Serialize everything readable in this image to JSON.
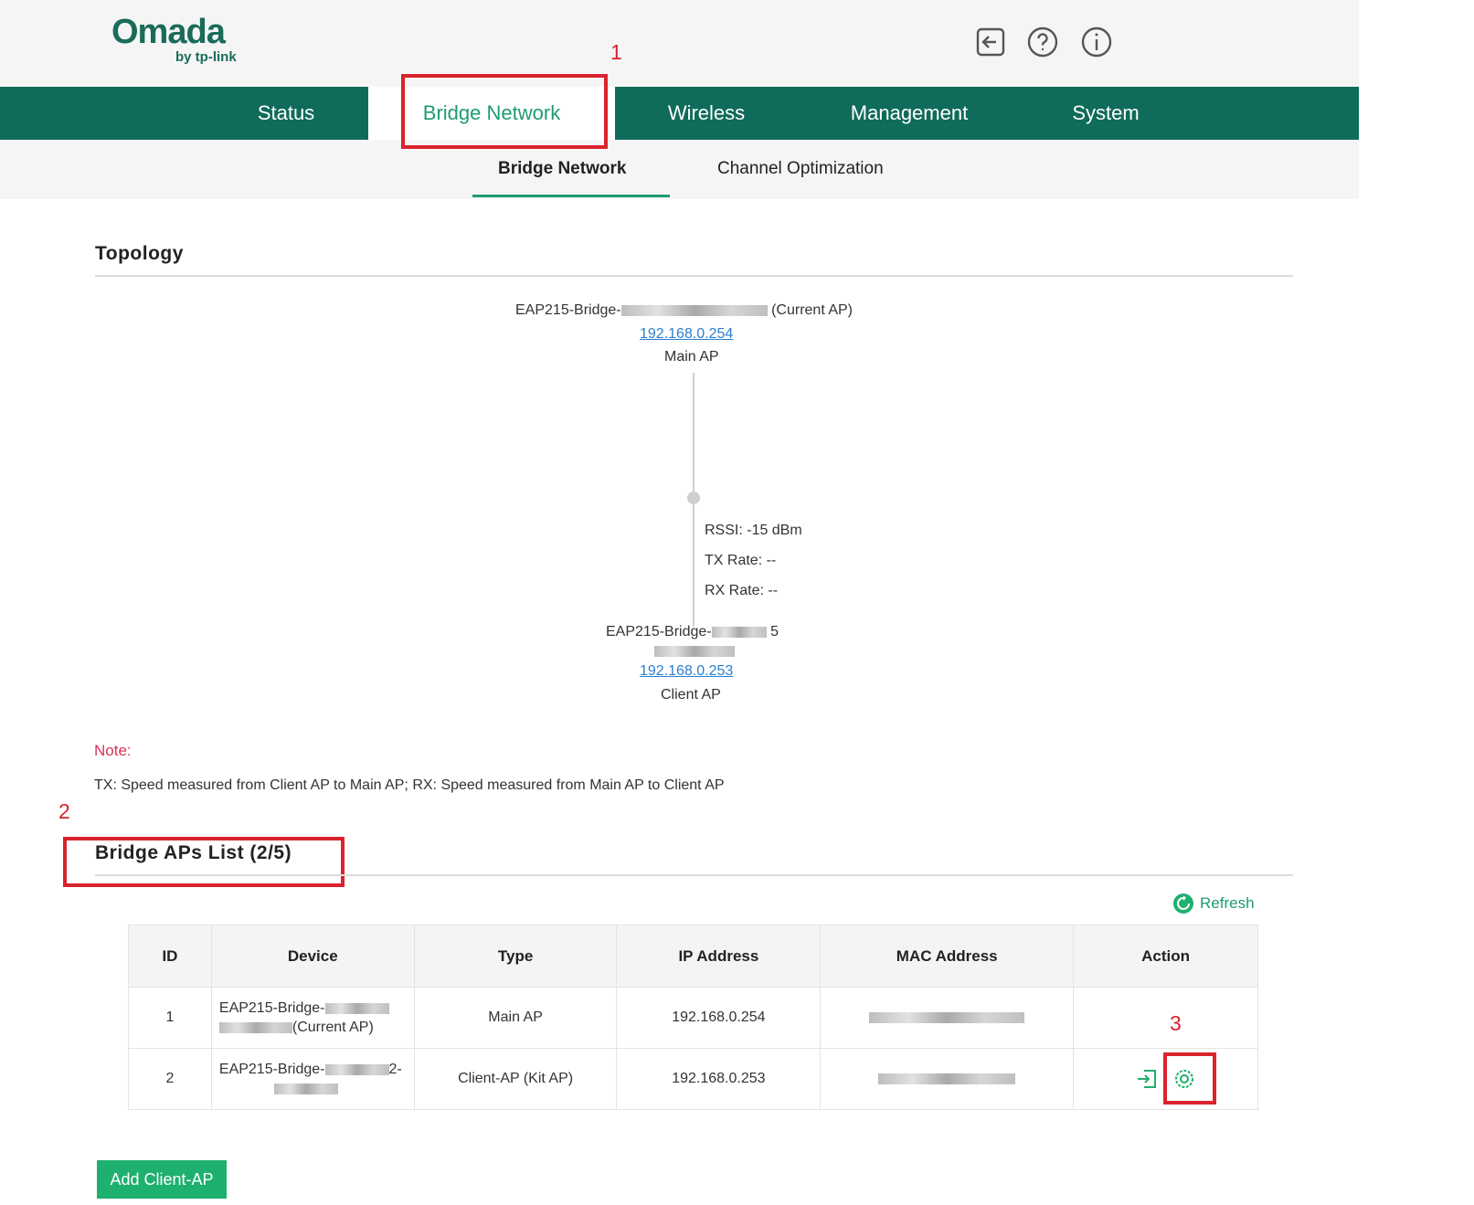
{
  "header": {
    "logo_main": "Omada",
    "logo_sub": "by tp-link"
  },
  "nav": {
    "tabs": [
      {
        "label": "Status"
      },
      {
        "label": "Bridge Network",
        "active": true
      },
      {
        "label": "Wireless"
      },
      {
        "label": "Management"
      },
      {
        "label": "System"
      }
    ]
  },
  "subnav": {
    "items": [
      {
        "label": "Bridge Network",
        "active": true
      },
      {
        "label": "Channel Optimization"
      }
    ]
  },
  "annotations": [
    "1",
    "2",
    "3"
  ],
  "topology": {
    "title": "Topology",
    "main_ap": {
      "name_prefix": "EAP215-Bridge-",
      "name_suffix": "(Current AP)",
      "ip": "192.168.0.254",
      "role": "Main AP"
    },
    "link": {
      "rssi": "RSSI: -15 dBm",
      "tx": "TX Rate: --",
      "rx": "RX Rate: --"
    },
    "client_ap": {
      "name_prefix": "EAP215-Bridge-",
      "name_suffix": "5",
      "ip": "192.168.0.253",
      "role": "Client AP"
    }
  },
  "note": {
    "label": "Note:",
    "text": "TX: Speed measured from Client AP to Main AP; RX: Speed measured from Main AP to Client AP"
  },
  "bridge_list": {
    "title": "Bridge APs List (2/5)",
    "refresh_label": "Refresh",
    "columns": [
      "ID",
      "Device",
      "Type",
      "IP Address",
      "MAC Address",
      "Action"
    ],
    "rows": [
      {
        "id": "1",
        "device_prefix": "EAP215-Bridge-",
        "device_suffix": "(Current AP)",
        "type": "Main AP",
        "ip": "192.168.0.254"
      },
      {
        "id": "2",
        "device_prefix": "EAP215-Bridge-",
        "device_suffix": "2-",
        "type": "Client-AP (Kit AP)",
        "ip": "192.168.0.253"
      }
    ]
  },
  "add_button": "Add Client-AP",
  "colors": {
    "brand": "#0f6b5a",
    "accent": "#1e9c6f",
    "annotation": "#d9232d",
    "note": "#d9325a",
    "link": "#2a7fd0"
  },
  "icons": [
    "logout-icon",
    "help-icon",
    "info-icon",
    "refresh-icon",
    "login-icon",
    "settings-icon"
  ]
}
